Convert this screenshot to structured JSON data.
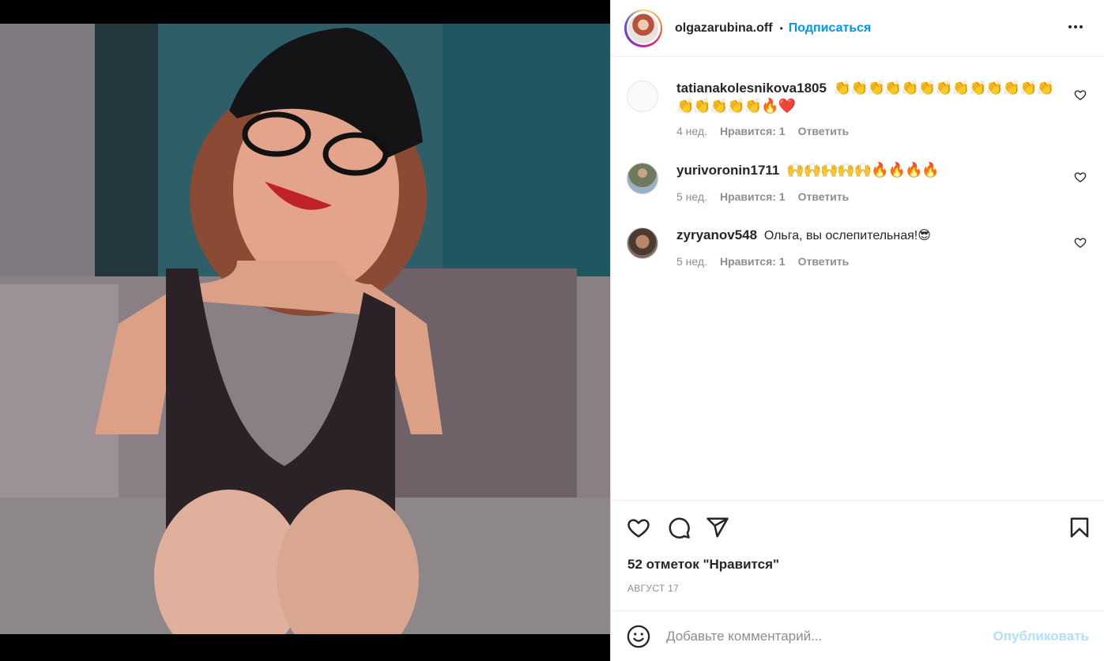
{
  "post": {
    "owner": "olgazarubina.off",
    "separator": "•",
    "follow_label": "Подписаться",
    "likes_text": "52 отметок \"Нравится\"",
    "date": "АВГУСТ 17"
  },
  "comments": [
    {
      "username": "tatianakolesnikova1805",
      "text": "👏👏👏👏👏👏👏👏👏👏👏👏👏👏👏👏👏👏🔥❤️",
      "age": "4 нед.",
      "likes": "Нравится: 1",
      "reply": "Ответить"
    },
    {
      "username": "yurivoronin1711",
      "text": "🙌🙌🙌🙌🙌🔥🔥🔥🔥",
      "age": "5 нед.",
      "likes": "Нравится: 1",
      "reply": "Ответить"
    },
    {
      "username": "zyryanov548",
      "text": "Ольга, вы ослепительная!😎",
      "age": "5 нед.",
      "likes": "Нравится: 1",
      "reply": "Ответить"
    }
  ],
  "composer": {
    "placeholder": "Добавьте комментарий...",
    "publish_label": "Опубликовать"
  },
  "icons": {
    "more": "more-options-icon",
    "like": "heart-icon",
    "comment": "comment-bubble-icon",
    "share": "paper-plane-icon",
    "save": "bookmark-icon",
    "emoji": "smiley-icon"
  },
  "colors": {
    "accent": "#0095f6",
    "publish_disabled": "#b2dffc",
    "secondary_text": "#8e8e8e",
    "primary_text": "#262626"
  }
}
